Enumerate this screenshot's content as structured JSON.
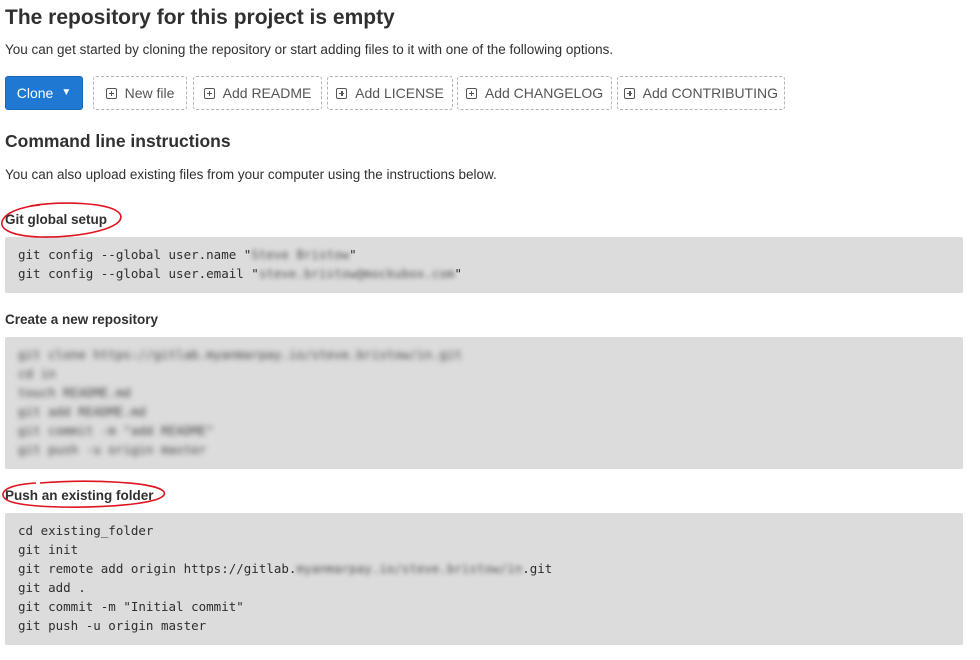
{
  "header": {
    "title": "The repository for this project is empty",
    "subtitle": "You can get started by cloning the repository or start adding files to it with one of the following options."
  },
  "actions": {
    "clone_label": "Clone",
    "new_file": "New file",
    "add_readme": "Add README",
    "add_license": "Add LICENSE",
    "add_changelog": "Add CHANGELOG",
    "add_contributing": "Add CONTRIBUTING"
  },
  "cli": {
    "heading": "Command line instructions",
    "description": "You can also upload existing files from your computer using the instructions below."
  },
  "git_global_setup": {
    "heading": "Git global setup",
    "line1_prefix": "git config --global user.name \"",
    "line1_blurred": "Steve Bristow",
    "line1_suffix": "\"",
    "line2_prefix": "git config --global user.email \"",
    "line2_blurred": "steve.bristow@mockubox.com",
    "line2_suffix": "\""
  },
  "new_repository": {
    "heading": "Create a new repository",
    "lines": [
      "git clone https://gitlab.myanmarpay.io/steve.bristow/in.git",
      "cd in",
      "touch README.md",
      "git add README.md",
      "git commit -m \"add README\"",
      "git push -u origin master"
    ]
  },
  "existing_folder": {
    "heading": "Push an existing folder",
    "line1": "cd existing_folder",
    "line2": "git init",
    "line3_prefix": "git remote add origin https://gitlab.",
    "line3_blurred": "myanmarpay.io/steve.bristow/in",
    "line3_suffix": ".git",
    "line4": "git add .",
    "line5": "git commit -m \"Initial commit\"",
    "line6": "git push -u origin master"
  },
  "colors": {
    "primary": "#1f78d1",
    "code_bg": "#dcdcdc",
    "annotation": "#e0141e"
  }
}
